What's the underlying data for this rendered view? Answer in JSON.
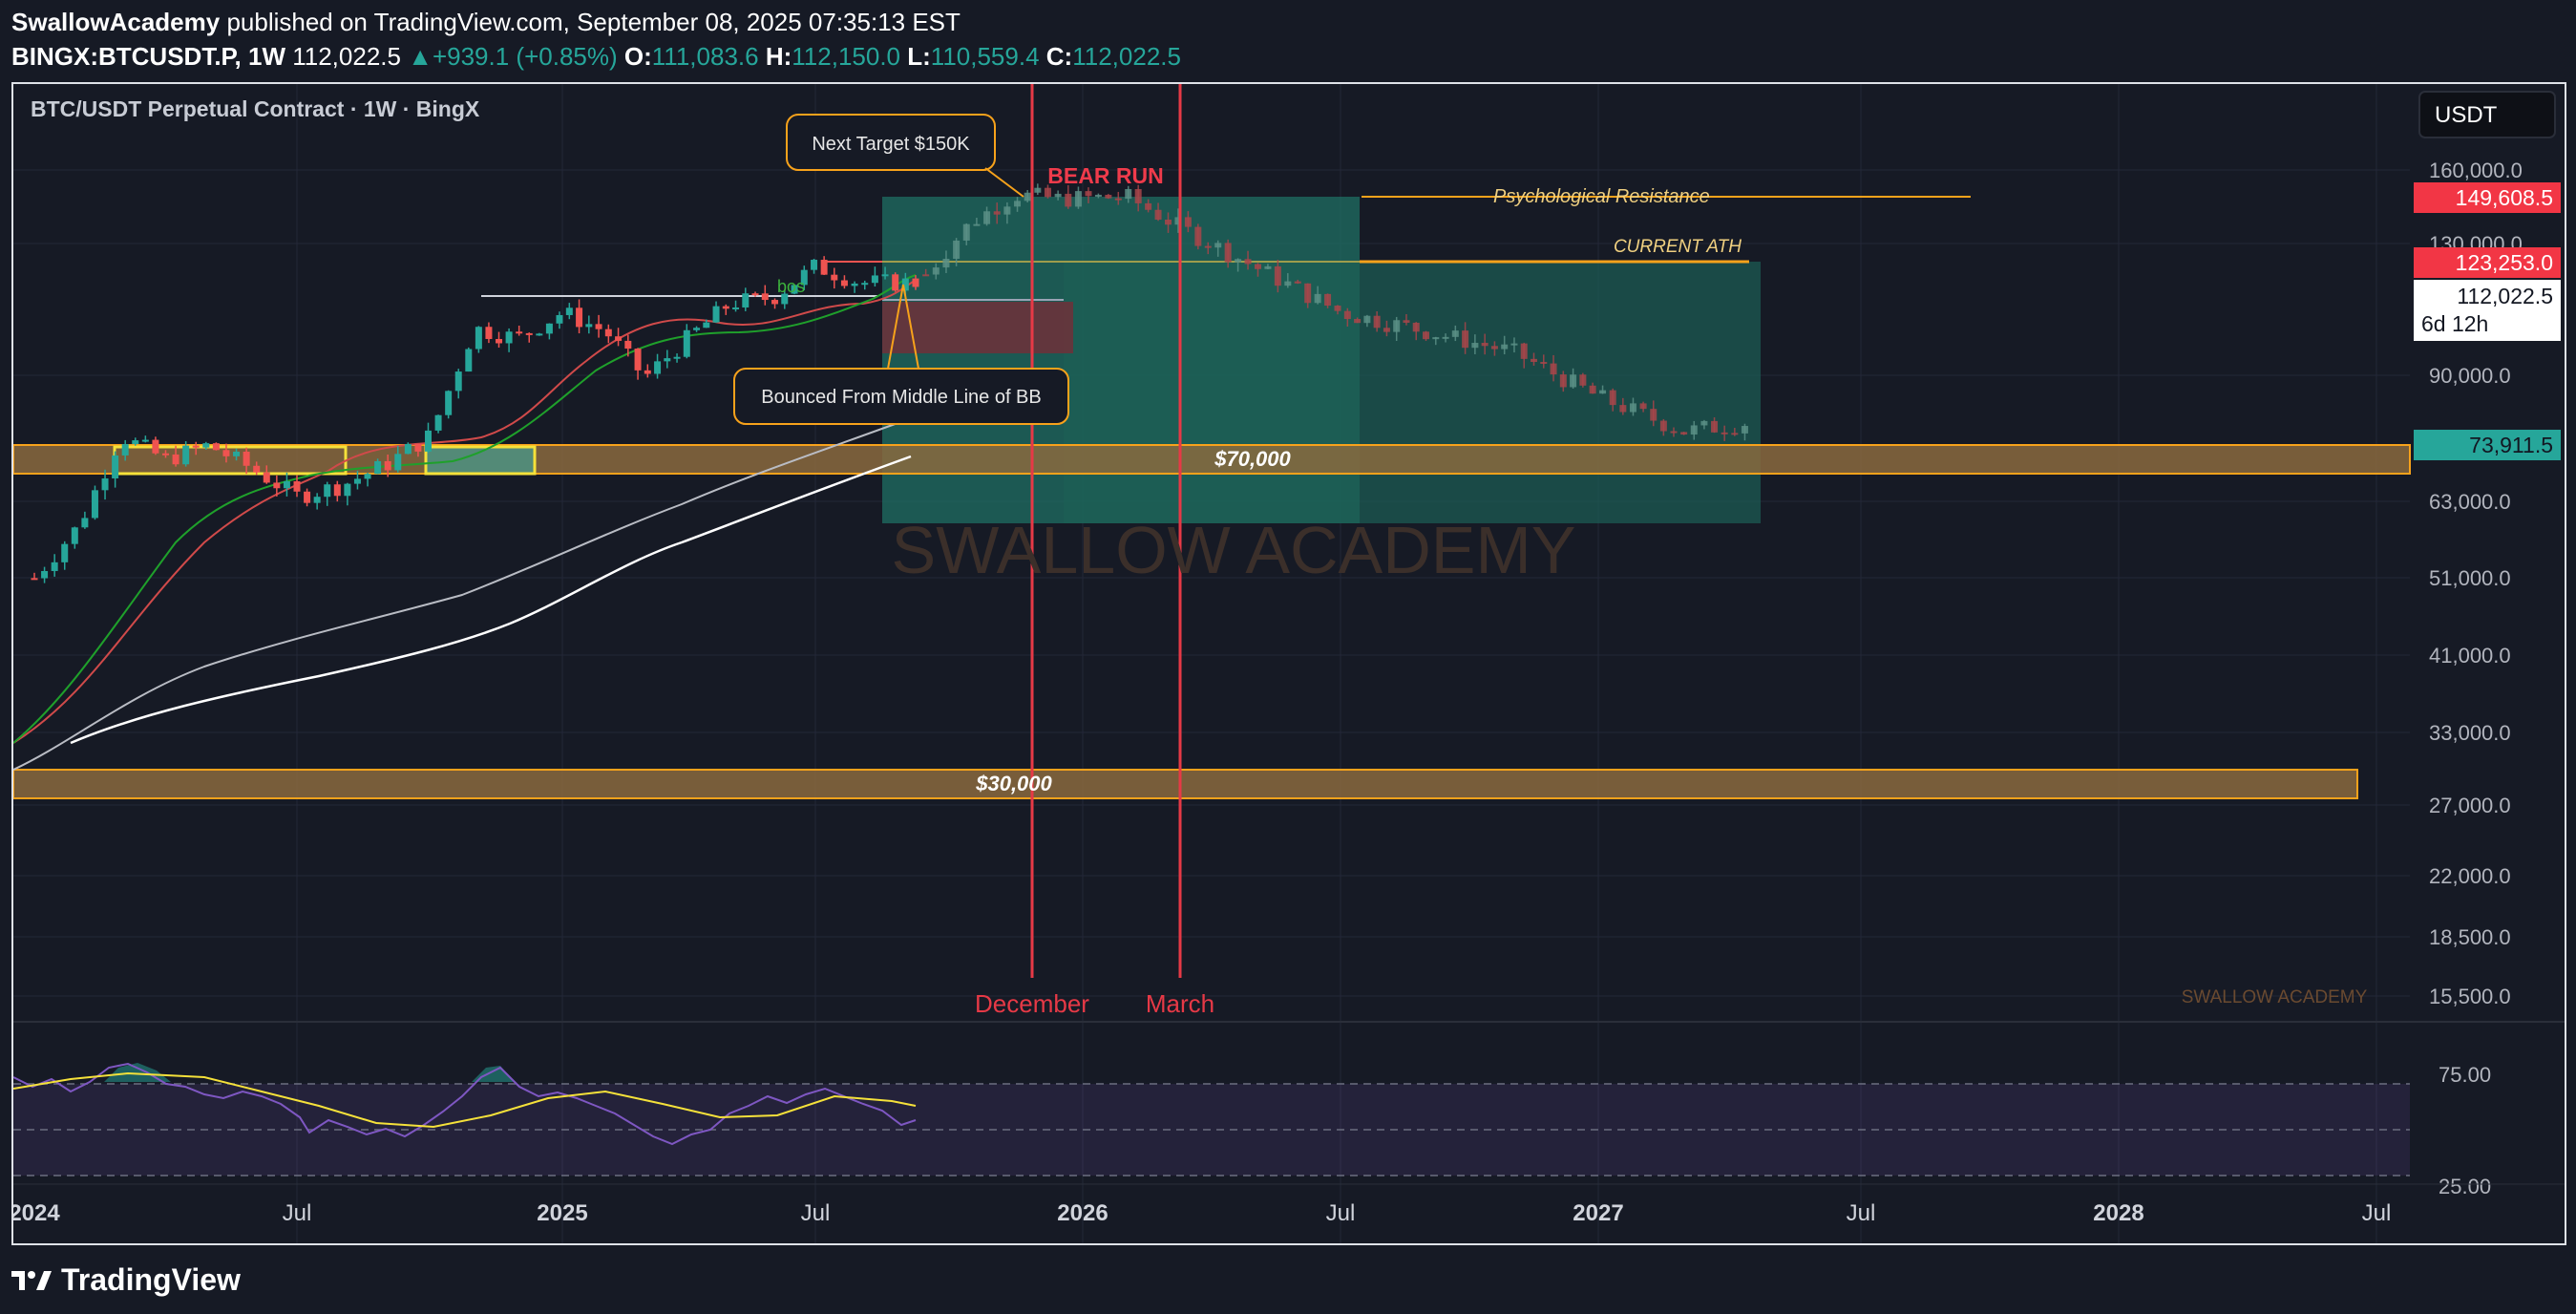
{
  "header": {
    "publisher": "SwallowAcademy",
    "published_text": "published on TradingView.com, September 08, 2025 07:35:13 EST",
    "symbol": "BINGX:BTCUSDT.P, 1W",
    "last": "112,022.5",
    "change": "+939.1 (+0.85%)",
    "open_label": "O:",
    "open": "111,083.6",
    "high_label": "H:",
    "high": "112,150.0",
    "low_label": "L:",
    "low": "110,559.4",
    "close_label": "C:",
    "close": "112,022.5"
  },
  "chart_title": "BTC/USDT Perpetual Contract · 1W · BingX",
  "currency_button": "USDT",
  "price_tags": {
    "psych": "149,608.5",
    "ath": "123,253.0",
    "current": "112,022.5",
    "countdown": "6d 12h",
    "support": "73,911.5"
  },
  "annotations": {
    "next_target": "Next Target $150K",
    "bear_run": "BEAR RUN",
    "psych_resistance": "Psychological Resistance",
    "current_ath": "CURRENT ATH",
    "bos": "bos",
    "bounced": "Bounced From Middle Line of BB",
    "zone_70k": "$70,000",
    "zone_30k": "$30,000",
    "december": "December",
    "march": "March",
    "watermark": "SWALLOW ACADEMY",
    "watermark_small": "SWALLOW ACADEMY"
  },
  "footer": {
    "brand": "TradingView"
  },
  "colors": {
    "background": "#161a25",
    "up": "#26a69a",
    "down": "#ef5350",
    "zone_fill": "#8a6a3e",
    "zone_border": "#f7a21b",
    "projection_fill": "#1f6f63",
    "red_line": "#e63946",
    "rsi": "#7e57c2",
    "rsi_ma": "#f5e13a"
  },
  "chart_data": {
    "type": "candlestick",
    "title": "BTC/USDT Perpetual Contract · 1W · BingX",
    "y_scale": "log",
    "y_ticks": [
      160000,
      130000,
      90000,
      63000,
      51000,
      41000,
      33000,
      27000,
      22000,
      18500,
      15500
    ],
    "y_tick_labels": [
      "160,000.0",
      "130,000.0",
      "90,000.0",
      "63,000.0",
      "51,000.0",
      "41,000.0",
      "33,000.0",
      "27,000.0",
      "22,000.0",
      "18,500.0",
      "15,500.0"
    ],
    "x_ticks": [
      "2024",
      "Jul",
      "2025",
      "Jul",
      "2026",
      "Jul",
      "2027",
      "Jul",
      "2028",
      "Jul"
    ],
    "x_tick_dates": [
      "2024-01-01",
      "2024-07-01",
      "2025-01-01",
      "2025-07-01",
      "2026-01-01",
      "2026-07-01",
      "2027-01-01",
      "2027-07-01",
      "2028-01-01",
      "2028-07-01"
    ],
    "levels": {
      "psychological_resistance": 149608.5,
      "current_ath": 123253.0,
      "last_price": 112022.5,
      "support_70k_zone": [
        69000,
        76000
      ],
      "support_30k_zone": [
        28000,
        31000
      ]
    },
    "vertical_markers": [
      {
        "label": "December",
        "date": "2025-12-01"
      },
      {
        "label": "March",
        "date": "2026-03-01"
      }
    ],
    "weekly_closes_approx": [
      {
        "date": "2024-01-01",
        "value": 44000
      },
      {
        "date": "2024-02-01",
        "value": 52000
      },
      {
        "date": "2024-03-01",
        "value": 69000
      },
      {
        "date": "2024-04-01",
        "value": 64000
      },
      {
        "date": "2024-05-01",
        "value": 67000
      },
      {
        "date": "2024-06-01",
        "value": 62000
      },
      {
        "date": "2024-07-01",
        "value": 57000
      },
      {
        "date": "2024-08-01",
        "value": 59000
      },
      {
        "date": "2024-09-01",
        "value": 63000
      },
      {
        "date": "2024-10-01",
        "value": 69000
      },
      {
        "date": "2024-11-01",
        "value": 97000
      },
      {
        "date": "2024-12-01",
        "value": 94000
      },
      {
        "date": "2025-01-01",
        "value": 102000
      },
      {
        "date": "2025-02-01",
        "value": 96000
      },
      {
        "date": "2025-03-01",
        "value": 83000
      },
      {
        "date": "2025-04-01",
        "value": 94000
      },
      {
        "date": "2025-05-01",
        "value": 105000
      },
      {
        "date": "2025-06-01",
        "value": 107000
      },
      {
        "date": "2025-07-01",
        "value": 118000
      },
      {
        "date": "2025-08-01",
        "value": 112000
      },
      {
        "date": "2025-09-08",
        "value": 112022.5
      }
    ],
    "projection_closes_approx": [
      {
        "date": "2025-09-15",
        "value": 115000
      },
      {
        "date": "2025-10-15",
        "value": 135000
      },
      {
        "date": "2025-11-15",
        "value": 148000
      },
      {
        "date": "2025-12-15",
        "value": 146000
      },
      {
        "date": "2026-02-01",
        "value": 147000
      },
      {
        "date": "2026-03-15",
        "value": 132000
      },
      {
        "date": "2026-05-01",
        "value": 118000
      },
      {
        "date": "2026-07-01",
        "value": 102000
      },
      {
        "date": "2026-09-01",
        "value": 96000
      },
      {
        "date": "2026-11-01",
        "value": 90000
      },
      {
        "date": "2027-01-01",
        "value": 78000
      },
      {
        "date": "2027-03-01",
        "value": 70000
      },
      {
        "date": "2027-04-15",
        "value": 72000
      }
    ],
    "rsi": {
      "levels": [
        75,
        25
      ],
      "level_labels": [
        "75.00",
        "25.00"
      ]
    }
  }
}
